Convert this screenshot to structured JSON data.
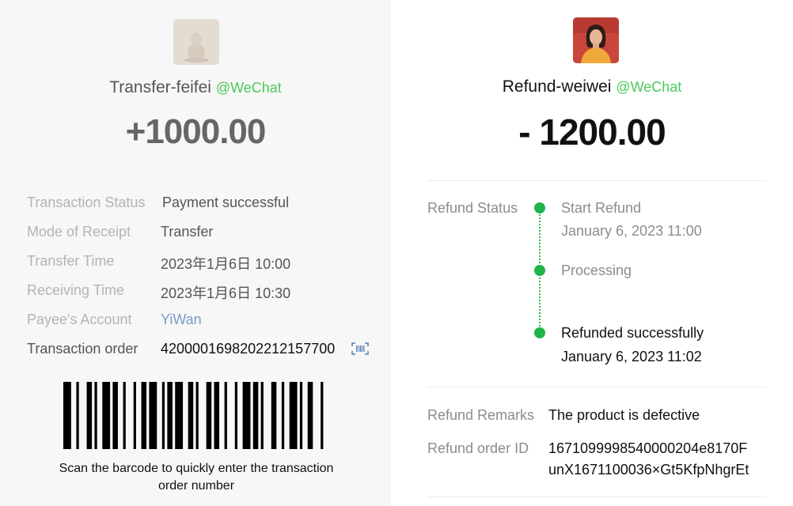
{
  "left": {
    "title": "Transfer-feifei",
    "title_suffix": "@WeChat",
    "amount": "+1000.00",
    "rows": [
      {
        "label": "Transaction Status",
        "value": "Payment successful"
      },
      {
        "label": "Mode of Receipt",
        "value": "Transfer"
      },
      {
        "label": "Transfer Time",
        "value": "2023年1月6日 10:00"
      },
      {
        "label": "Receiving Time",
        "value": "2023年1月6日 10:30"
      },
      {
        "label": "Payee's Account",
        "value": "YiWan"
      },
      {
        "label": "Transaction order",
        "value": "4200001698202212157700"
      }
    ],
    "barcode_caption": "Scan the barcode to quickly enter the transaction order number"
  },
  "right": {
    "title": "Refund-weiwei",
    "title_suffix": "@WeChat",
    "amount": "- 1200.00",
    "refund_status_label": "Refund Status",
    "timeline": [
      {
        "title": "Start Refund",
        "time": "January 6, 2023 11:00"
      },
      {
        "title": "Processing",
        "time": ""
      },
      {
        "title": "Refunded successfully",
        "time": "January 6, 2023 11:02"
      }
    ],
    "remarks_label": "Refund Remarks",
    "remarks_value": "The product is defective",
    "order_id_label": "Refund order ID",
    "order_id_line1": "1671099998540000204e8170F",
    "order_id_line2": "unX1671100036×Gt5KfpNhgrEt"
  },
  "colors": {
    "accent_green": "#20b44a",
    "wechat_green": "#4cc85a",
    "link_blue": "#7a9cc6"
  }
}
